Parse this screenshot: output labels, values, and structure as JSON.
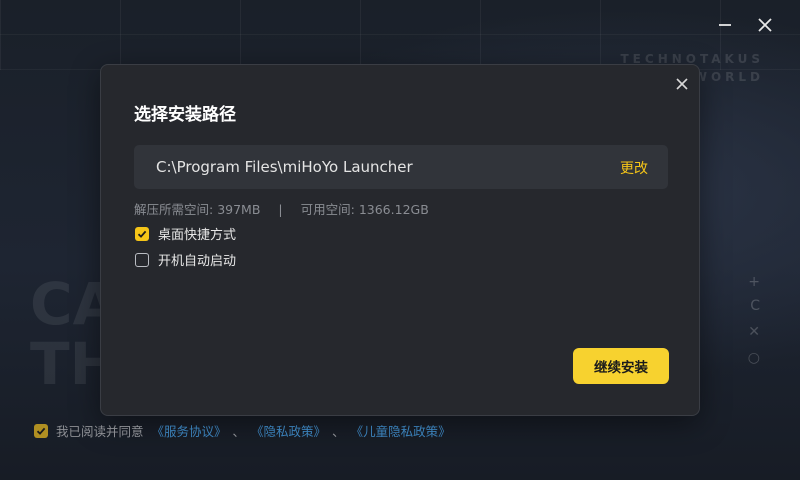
{
  "window": {
    "minimize_icon": "minimize-icon",
    "close_icon": "close-icon"
  },
  "background": {
    "top_right_line1": "TECHNOTAKUS",
    "top_right_line2": "SAVE WORLD",
    "big_text1": "CA",
    "big_text2": "TH"
  },
  "dialog": {
    "title": "选择安装路径",
    "path": "C:\\Program Files\\miHoYo Launcher",
    "change_label": "更改",
    "required_space_label": "解压所需空间:",
    "required_space_value": "397MB",
    "separator": "|",
    "available_space_label": "可用空间:",
    "available_space_value": "1366.12GB",
    "options": [
      {
        "label": "桌面快捷方式",
        "checked": true
      },
      {
        "label": "开机自动启动",
        "checked": false
      }
    ],
    "install_button": "继续安装"
  },
  "agreement": {
    "checked": true,
    "prefix": "我已阅读并同意",
    "links": [
      "《服务协议》",
      "《隐私政策》",
      "《儿童隐私政策》"
    ],
    "separator": "、"
  },
  "colors": {
    "accent": "#f7d22f",
    "link": "#3a7fb7",
    "dialog_bg": "#26282d"
  }
}
